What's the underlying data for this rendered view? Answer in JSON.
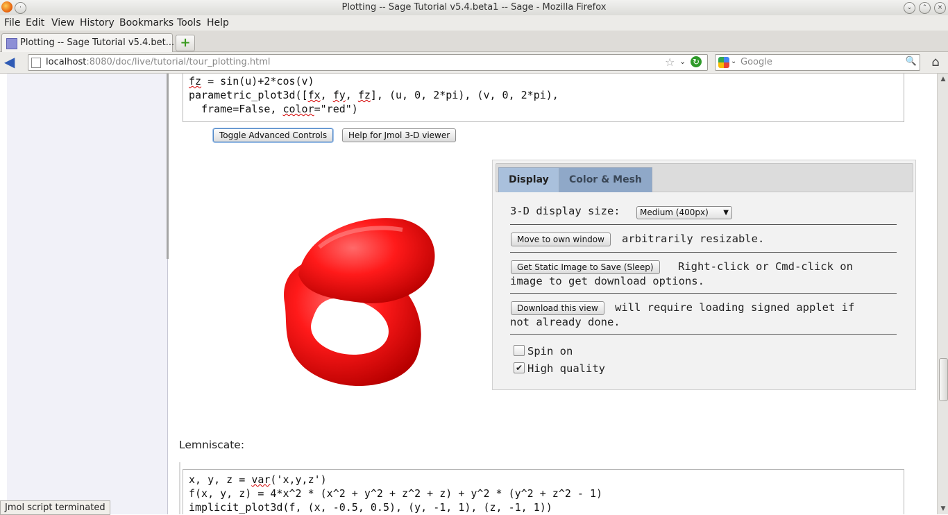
{
  "window": {
    "title": "Plotting -- Sage Tutorial v5.4.beta1 -- Sage - Mozilla Firefox"
  },
  "menu": [
    "File",
    "Edit",
    "View",
    "History",
    "Bookmarks",
    "Tools",
    "Help"
  ],
  "tab": {
    "label": "Plotting -- Sage Tutorial v5.4.bet..."
  },
  "nav": {
    "url_host": "localhost",
    "url_rest": ":8080/doc/live/tutorial/tour_plotting.html",
    "search_placeholder": "Google"
  },
  "code_top": {
    "line1a": "fz",
    "line1b": " = sin(u)+2*cos(v)",
    "line2a": "parametric_plot3d([",
    "line2b": "fx",
    "line2c": ", ",
    "line2d": "fy",
    "line2e": ", ",
    "line2f": "fz",
    "line2g": "], (u, 0, 2*pi), (v, 0, 2*pi),",
    "line3a": "  frame=False, ",
    "line3b": "color",
    "line3c": "=\"red\")"
  },
  "buttons": {
    "toggle_advanced": "Toggle Advanced Controls",
    "help_jmol": "Help for Jmol 3-D viewer"
  },
  "panel": {
    "tabs": [
      "Display",
      "Color & Mesh"
    ],
    "display_size_label": "3-D display size:",
    "display_size_value": "Medium (400px)",
    "move_button": "Move to own window",
    "move_text": "arbitrarily resizable.",
    "static_button": "Get Static Image to Save (Sleep)",
    "static_text1": "Right-click or Cmd-click on",
    "static_text2": "image to get download options.",
    "download_button": "Download this view",
    "download_text1": "will require loading signed applet if",
    "download_text2": "not already done.",
    "spin_label": "Spin on",
    "spin_checked": false,
    "hq_label": "High quality",
    "hq_checked": true,
    "check_mark": "✔"
  },
  "lemniscate_label": "Lemniscate:",
  "code_bottom": {
    "line1a": "x, y, z = ",
    "line1b": "var",
    "line1c": "('x,y,z')",
    "line2": "f(x, y, z) = 4*x^2 * (x^2 + y^2 + z^2 + z) + y^2 * (y^2 + z^2 - 1)",
    "line3": "implicit_plot3d(f, (x, -0.5, 0.5), (y, -1, 1), (z, -1, 1))"
  },
  "status": "Jmol script terminated",
  "colors": {
    "plot_red": "#ff1a1a",
    "tab_blue": "#9cb3cf"
  }
}
